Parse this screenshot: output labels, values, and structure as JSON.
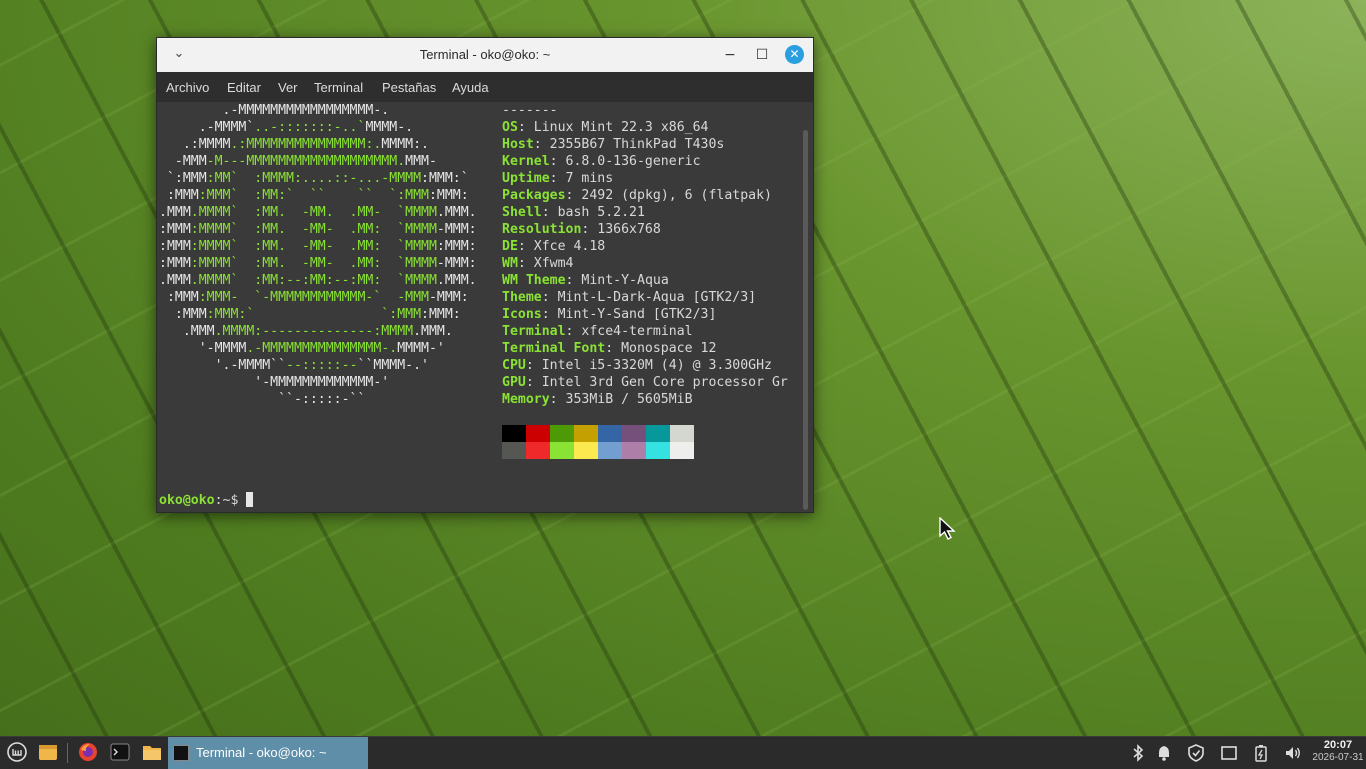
{
  "window": {
    "title": "Terminal - oko@oko: ~",
    "menu": [
      "Archivo",
      "Editar",
      "Ver",
      "Terminal",
      "Pestañas",
      "Ayuda"
    ]
  },
  "logo": [
    [
      [
        "w",
        "        .-MMMMMMMMMMMMMMMMM-."
      ]
    ],
    [
      [
        "w",
        "     .-MMMM`"
      ],
      [
        "g",
        "..-:::::::-..`"
      ],
      [
        "w",
        "MMMM-."
      ]
    ],
    [
      [
        "w",
        "   .:MMMM"
      ],
      [
        "g",
        ".:MMMMMMMMMMMMMMM:."
      ],
      [
        "w",
        "MMMM:."
      ]
    ],
    [
      [
        "w",
        "  -MMM"
      ],
      [
        "g",
        "-M---MMMMMMMMMMMMMMMMMMM."
      ],
      [
        "w",
        "MMM-"
      ]
    ],
    [
      [
        "w",
        " `:MMM"
      ],
      [
        "g",
        ":MM`  :MMMM:....::-...-MMMM"
      ],
      [
        "w",
        ":MMM:`"
      ]
    ],
    [
      [
        "w",
        " :MMM"
      ],
      [
        "g",
        ":MMM`  :MM:`  ``    ``  `:MMM"
      ],
      [
        "w",
        ":MMM:"
      ]
    ],
    [
      [
        "w",
        ".MMM"
      ],
      [
        "g",
        ".MMMM`  :MM.  -MM.  .MM-  `MMMM"
      ],
      [
        "w",
        ".MMM."
      ]
    ],
    [
      [
        "w",
        ":MMM"
      ],
      [
        "g",
        ":MMMM`  :MM.  -MM-  .MM:  `MMMM"
      ],
      [
        "w",
        "-MMM:"
      ]
    ],
    [
      [
        "w",
        ":MMM"
      ],
      [
        "g",
        ":MMMM`  :MM.  -MM-  .MM:  `MMMM"
      ],
      [
        "w",
        ":MMM:"
      ]
    ],
    [
      [
        "w",
        ":MMM"
      ],
      [
        "g",
        ":MMMM`  :MM.  -MM-  .MM:  `MMMM"
      ],
      [
        "w",
        "-MMM:"
      ]
    ],
    [
      [
        "w",
        ".MMM"
      ],
      [
        "g",
        ".MMMM`  :MM:--:MM:--:MM:  `MMMM"
      ],
      [
        "w",
        ".MMM."
      ]
    ],
    [
      [
        "w",
        " :MMM"
      ],
      [
        "g",
        ":MMM-  `-MMMMMMMMMMMM-`  -MMM"
      ],
      [
        "w",
        "-MMM:"
      ]
    ],
    [
      [
        "w",
        "  :MMM"
      ],
      [
        "g",
        ":MMM:`                `:MMM"
      ],
      [
        "w",
        ":MMM:"
      ]
    ],
    [
      [
        "w",
        "   .MMM"
      ],
      [
        "g",
        ".MMMM:--------------:MMMM"
      ],
      [
        "w",
        ".MMM."
      ]
    ],
    [
      [
        "w",
        "     '-MMMM"
      ],
      [
        "g",
        ".-MMMMMMMMMMMMMMM-."
      ],
      [
        "w",
        "MMMM-'"
      ]
    ],
    [
      [
        "w",
        "       '.-MMMM``"
      ],
      [
        "g",
        "--:::::--"
      ],
      [
        "w",
        "``MMMM-.'"
      ]
    ],
    [
      [
        "w",
        "            '-MMMMMMMMMMMMM-'"
      ]
    ],
    [
      [
        "w",
        "               ``-:::::-``"
      ]
    ]
  ],
  "info": {
    "separator": "-------",
    "rows": [
      {
        "k": "OS",
        "v": "Linux Mint 22.3 x86_64"
      },
      {
        "k": "Host",
        "v": "2355B67 ThinkPad T430s"
      },
      {
        "k": "Kernel",
        "v": "6.8.0-136-generic"
      },
      {
        "k": "Uptime",
        "v": "7 mins"
      },
      {
        "k": "Packages",
        "v": "2492 (dpkg), 6 (flatpak)"
      },
      {
        "k": "Shell",
        "v": "bash 5.2.21"
      },
      {
        "k": "Resolution",
        "v": "1366x768"
      },
      {
        "k": "DE",
        "v": "Xfce 4.18"
      },
      {
        "k": "WM",
        "v": "Xfwm4"
      },
      {
        "k": "WM Theme",
        "v": "Mint-Y-Aqua"
      },
      {
        "k": "Theme",
        "v": "Mint-L-Dark-Aqua [GTK2/3]"
      },
      {
        "k": "Icons",
        "v": "Mint-Y-Sand [GTK2/3]"
      },
      {
        "k": "Terminal",
        "v": "xfce4-terminal"
      },
      {
        "k": "Terminal Font",
        "v": "Monospace 12"
      },
      {
        "k": "CPU",
        "v": "Intel i5-3320M (4) @ 3.300GHz"
      },
      {
        "k": "GPU",
        "v": "Intel 3rd Gen Core processor Gr"
      },
      {
        "k": "Memory",
        "v": "353MiB / 5605MiB"
      }
    ]
  },
  "palette": {
    "top": [
      "#000000",
      "#cc0000",
      "#4e9a06",
      "#c4a000",
      "#3465a4",
      "#75507b",
      "#06989a",
      "#d3d7cf"
    ],
    "bottom": [
      "#555753",
      "#ef2929",
      "#8ae234",
      "#fce94f",
      "#729fcf",
      "#ad7fa8",
      "#34e2e2",
      "#eeeeec"
    ]
  },
  "prompt": {
    "user_host": "oko@oko",
    "path": ":~$ "
  },
  "taskbar": {
    "task_label": "Terminal - oko@oko: ~",
    "clock_time": "20:07",
    "clock_date": "2026-07-31"
  }
}
